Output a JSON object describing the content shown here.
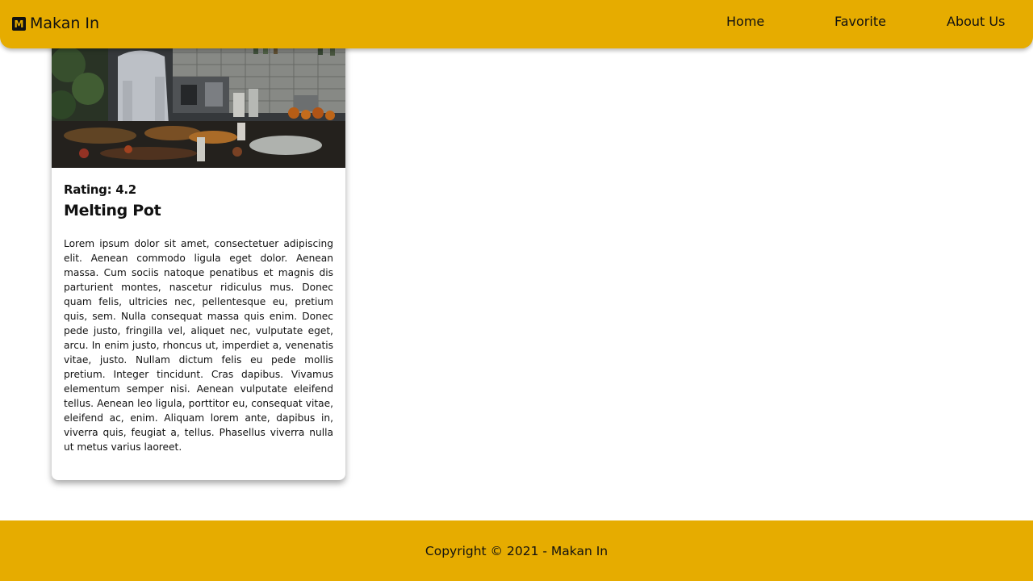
{
  "brand": {
    "icon": "restaurant-logo-icon",
    "icon_letter": "M",
    "name": "Makan In"
  },
  "nav": {
    "items": [
      {
        "label": "Home"
      },
      {
        "label": "Favorite"
      },
      {
        "label": "About Us"
      }
    ]
  },
  "restaurant_card": {
    "rating_text": "Rating: 4.2",
    "name": "Melting Pot",
    "description": "Lorem ipsum dolor sit amet, consectetuer adipiscing elit. Aenean commodo ligula eget dolor. Aenean massa. Cum sociis natoque penatibus et magnis dis parturient montes, nascetur ridiculus mus. Donec quam felis, ultricies nec, pellentesque eu, pretium quis, sem. Nulla consequat massa quis enim. Donec pede justo, fringilla vel, aliquet nec, vulputate eget, arcu. In enim justo, rhoncus ut, imperdiet a, venenatis vitae, justo. Nullam dictum felis eu pede mollis pretium. Integer tincidunt. Cras dapibus. Vivamus elementum semper nisi. Aenean vulputate eleifend tellus. Aenean leo ligula, porttitor eu, consequat vitae, eleifend ac, enim. Aliquam lorem ante, dapibus in, viverra quis, feugiat a, tellus. Phasellus viverra nulla ut metus varius laoreet."
  },
  "footer": {
    "copyright": "Copyright © 2021 - Makan In"
  },
  "colors": {
    "accent": "#e6ac00",
    "text": "#111111",
    "background": "#ffffff"
  }
}
